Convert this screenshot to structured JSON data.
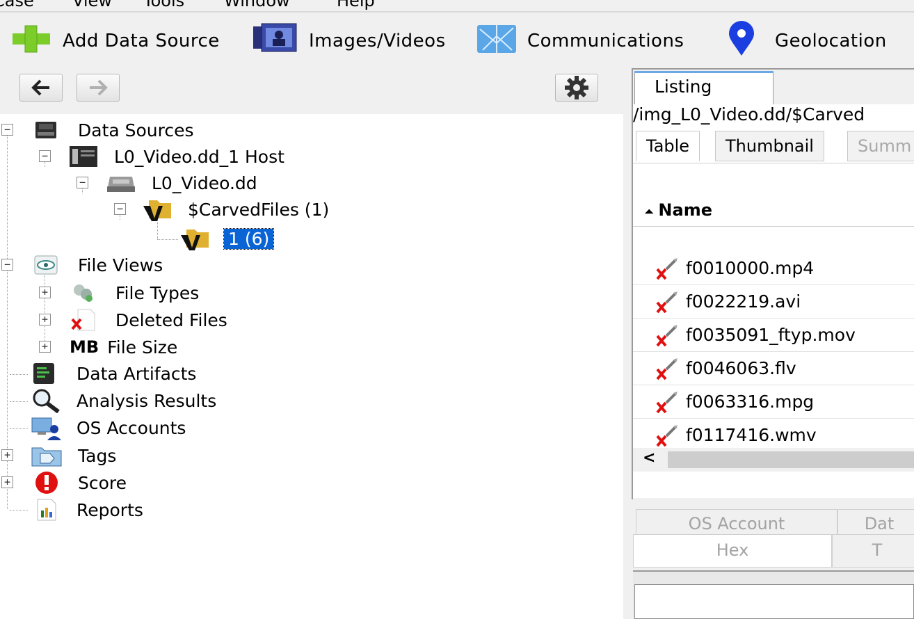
{
  "menubar": {
    "items": [
      "Case",
      "View",
      "Tools",
      "Window",
      "Help"
    ]
  },
  "toolbar": {
    "add_data_source": "Add Data Source",
    "images_videos": "Images/Videos",
    "communications": "Communications",
    "geolocation": "Geolocation"
  },
  "tree": {
    "data_sources": "Data Sources",
    "host": "L0_Video.dd_1 Host",
    "image": "L0_Video.dd",
    "carved": "$CarvedFiles (1)",
    "selected_folder": "1 (6)",
    "file_views": "File Views",
    "file_types": "File Types",
    "deleted_files": "Deleted Files",
    "mb_icon_text": "MB",
    "file_size": "File Size",
    "data_artifacts": "Data Artifacts",
    "analysis_results": "Analysis Results",
    "os_accounts": "OS Accounts",
    "tags": "Tags",
    "score": "Score",
    "reports": "Reports"
  },
  "listing": {
    "tab": "Listing",
    "path": "/img_L0_Video.dd/$Carved",
    "subtabs": [
      "Table",
      "Thumbnail",
      "Summ"
    ],
    "column_header": "Name",
    "sort_glyph": "⏶",
    "files": [
      "f0010000.mp4",
      "f0022219.avi",
      "f0035091_ftyp.mov",
      "f0046063.flv",
      "f0063316.mpg",
      "f0117416.wmv"
    ],
    "scroll_left": "<"
  },
  "content_viewer": {
    "tabs_row1": [
      "OS Account",
      "Dat"
    ],
    "tabs_row2": [
      "Hex",
      "T"
    ]
  },
  "colors": {
    "selection": "#0a64d6",
    "add_green": "#7ccc2a",
    "geo_blue": "#1a3ee0",
    "score_red": "#e01010"
  }
}
